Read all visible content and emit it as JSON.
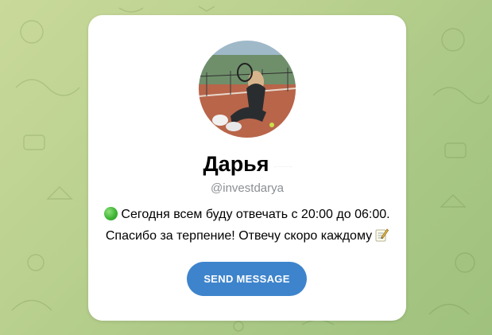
{
  "profile": {
    "name": "Дарья",
    "flag_icon": "russia-flag-icon",
    "handle": "@investdarya",
    "bio_line1": "Сегодня всем буду отвечать с 20:00 до 06:00.",
    "bio_line2": "Спасибо за терпение! Отвечу скоро каждому",
    "status_icon": "green-circle-icon",
    "trailing_icon": "memo-icon"
  },
  "actions": {
    "send_label": "SEND MESSAGE"
  },
  "colors": {
    "accent": "#3e84cc",
    "handle_text": "#8b8f93",
    "card": "#ffffff"
  }
}
